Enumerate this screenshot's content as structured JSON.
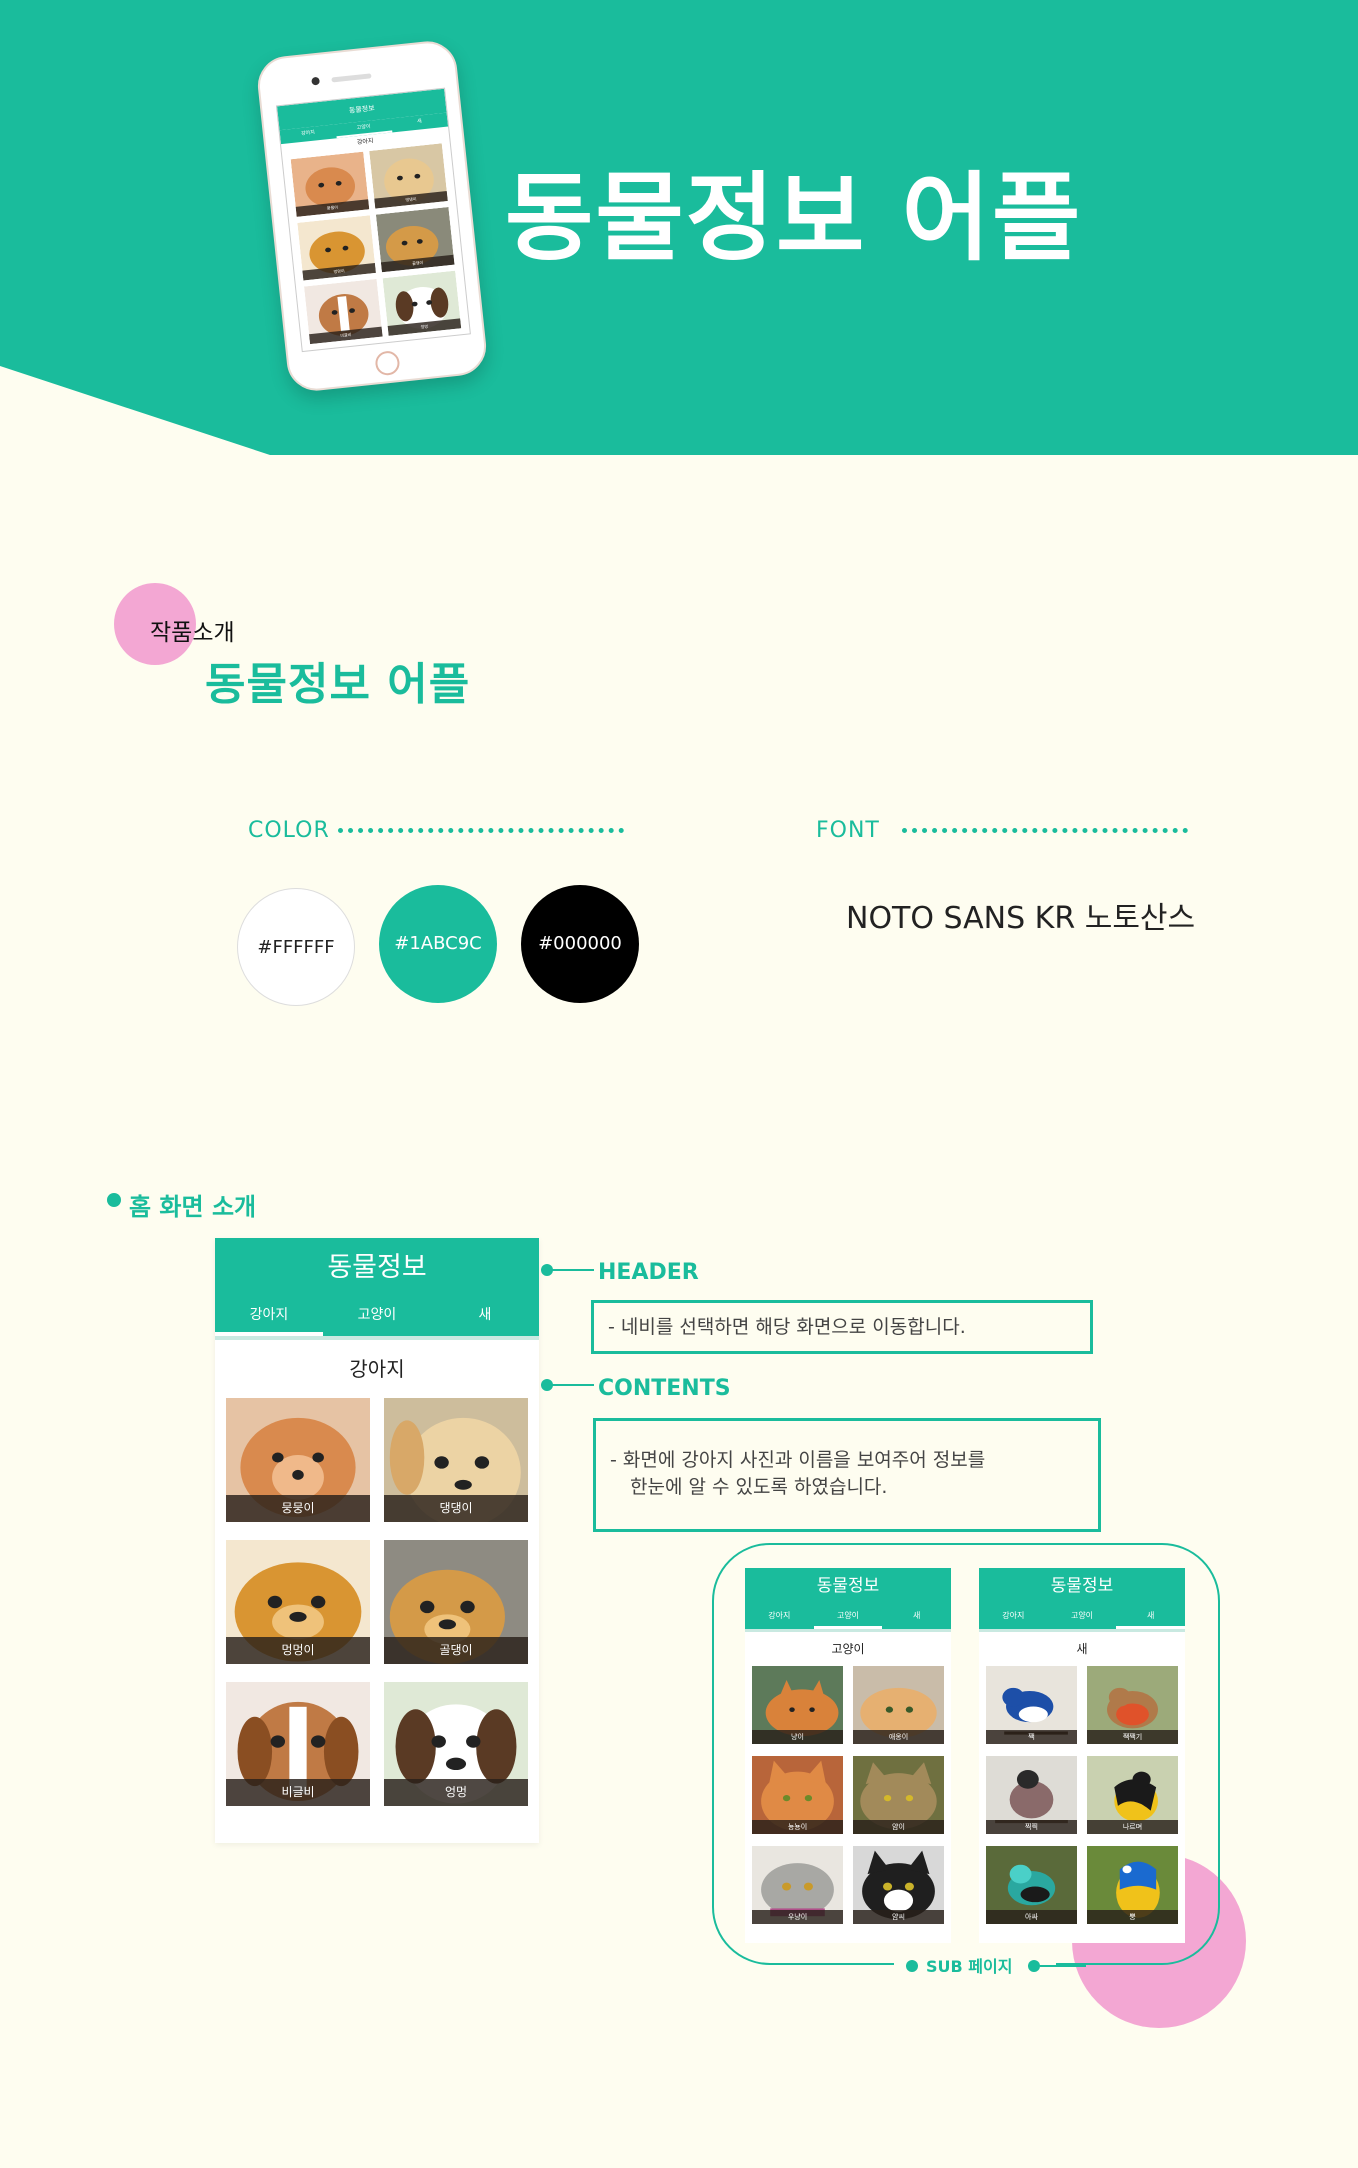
{
  "colors": {
    "accent": "#1abc9c",
    "background": "#fefdf0",
    "pink": "#f3a7d3"
  },
  "hero": {
    "title": "동물정보 어플"
  },
  "hero_app": {
    "header": "동물정보",
    "tabs": [
      "강아지",
      "고양이",
      "새"
    ],
    "section": "강아지",
    "cards": [
      "뭉뭉이",
      "댕댕이",
      "멍멍이",
      "골댕이",
      "비글비",
      "엉멍"
    ]
  },
  "intro": {
    "label": "작품소개",
    "title": "동물정보 어플"
  },
  "color_section": {
    "label": "COLOR",
    "swatches": [
      "#FFFFFF",
      "#1ABC9C",
      "#000000"
    ]
  },
  "font_section": {
    "label": "FONT",
    "sample": "NOTO SANS KR 노토산스"
  },
  "home": {
    "title": "홈 화면 소개",
    "app": {
      "header": "동물정보",
      "tabs": [
        "강아지",
        "고양이",
        "새"
      ],
      "section": "강아지",
      "cards": [
        "뭉뭉이",
        "댕댕이",
        "멍멍이",
        "골댕이",
        "비글비",
        "엉멍"
      ]
    },
    "header_callout": {
      "label": "HEADER",
      "text": "- 네비를 선택하면 해당 화면으로 이동합니다."
    },
    "contents_callout": {
      "label": "CONTENTS",
      "line1": "-  화면에 강아지 사진과 이름을 보여주어 정보를",
      "line2": "한눈에 알 수 있도록 하였습니다."
    }
  },
  "sub": {
    "label": "SUB 페이지",
    "cat_app": {
      "header": "동물정보",
      "tabs": [
        "강아지",
        "고양이",
        "새"
      ],
      "section": "고양이",
      "cards": [
        "냥이",
        "애옹이",
        "뇽뇽이",
        "얌이",
        "우냥이",
        "얌씨"
      ]
    },
    "bird_app": {
      "header": "동물정보",
      "tabs": [
        "강아지",
        "고양이",
        "새"
      ],
      "section": "새",
      "cards": [
        "짹",
        "짹짹기",
        "찍찍",
        "나르며",
        "아싸",
        "뿡"
      ]
    }
  }
}
